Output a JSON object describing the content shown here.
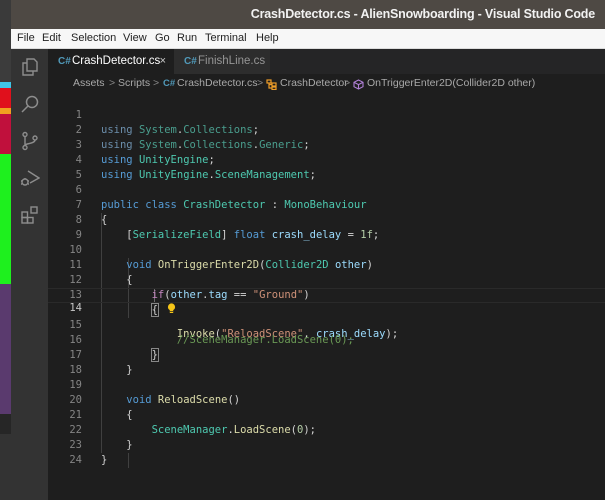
{
  "window": {
    "title": "CrashDetector.cs - AlienSnowboarding - Visual Studio Code"
  },
  "menu": [
    "File",
    "Edit",
    "Selection",
    "View",
    "Go",
    "Run",
    "Terminal",
    "Help"
  ],
  "activity_bar": [
    {
      "name": "explorer-icon"
    },
    {
      "name": "search-icon"
    },
    {
      "name": "source-control-icon"
    },
    {
      "name": "run-debug-icon"
    },
    {
      "name": "extensions-icon"
    }
  ],
  "tabs": [
    {
      "label": "CrashDetector.cs",
      "icon": "C#",
      "active": true,
      "close": "×"
    },
    {
      "label": "FinishLine.cs",
      "icon": "C#",
      "active": false
    }
  ],
  "breadcrumb": {
    "items": [
      "Assets",
      "Scripts",
      "CrashDetector.cs",
      "CrashDetector",
      "OnTriggerEnter2D(Collider2D other)"
    ],
    "separator": ">"
  },
  "editor": {
    "current_line": 14,
    "lines": [
      {
        "n": "1",
        "text": "using System.Collections;"
      },
      {
        "n": "2",
        "text": "using System.Collections.Generic;"
      },
      {
        "n": "3",
        "text": "using UnityEngine;"
      },
      {
        "n": "4",
        "text": "using UnityEngine.SceneManagement;"
      },
      {
        "n": "5",
        "text": ""
      },
      {
        "n": "6",
        "text": "public class CrashDetector : MonoBehaviour"
      },
      {
        "n": "7",
        "text": "{"
      },
      {
        "n": "8",
        "text": "    [SerializeField] float crash_delay = 1f;"
      },
      {
        "n": "9",
        "text": ""
      },
      {
        "n": "10",
        "text": "    void OnTriggerEnter2D(Collider2D other)"
      },
      {
        "n": "11",
        "text": "    {"
      },
      {
        "n": "12",
        "text": "        if(other.tag == \"Ground\")"
      },
      {
        "n": "13",
        "text": "        {"
      },
      {
        "n": "14",
        "text": "            Invoke(\"ReloadScene\", crash_delay);"
      },
      {
        "n": "15",
        "text": "            //SceneManager.LoadScene(0);"
      },
      {
        "n": "16",
        "text": "        }"
      },
      {
        "n": "17",
        "text": "    }"
      },
      {
        "n": "18",
        "text": ""
      },
      {
        "n": "19",
        "text": "    void ReloadScene()"
      },
      {
        "n": "20",
        "text": "    {"
      },
      {
        "n": "21",
        "text": "        SceneManager.LoadScene(0);"
      },
      {
        "n": "22",
        "text": "    }"
      },
      {
        "n": "23",
        "text": "}"
      },
      {
        "n": "24",
        "text": ""
      }
    ]
  },
  "tokens": {
    "using": "using",
    "System": "System",
    "Collections": "Collections",
    "Generic": "Generic",
    "UnityEngine": "UnityEngine",
    "SceneManagement": "SceneManagement",
    "public": "public",
    "class": "class",
    "CrashDetector": "CrashDetector",
    "colon": ":",
    "MonoBehaviour": "MonoBehaviour",
    "SerializeField": "SerializeField",
    "float": "float",
    "crash_delay": "crash_delay",
    "eq": "=",
    "one_f": "1f",
    "void": "void",
    "OnTriggerEnter2D": "OnTriggerEnter2D",
    "Collider2D": "Collider2D",
    "other": "other",
    "if": "if",
    "tag": "tag",
    "eqeq": "==",
    "ground_str": "\"Ground\"",
    "Invoke": "Invoke",
    "reload_str": "\"ReloadScene\"",
    "comment": "//SceneManager.LoadScene(0);",
    "ReloadScene": "ReloadScene",
    "SceneManager": "SceneManager",
    "LoadScene": "LoadScene",
    "zero": "0"
  },
  "colors": {
    "keyword": "#569cd6",
    "type": "#4ec9b0",
    "function": "#dcdcaa",
    "variable": "#9cdcfe",
    "string": "#ce9178",
    "number": "#b5cea8",
    "comment": "#6a9955",
    "control": "#c586c0",
    "lightbulb": "#f5c518"
  }
}
